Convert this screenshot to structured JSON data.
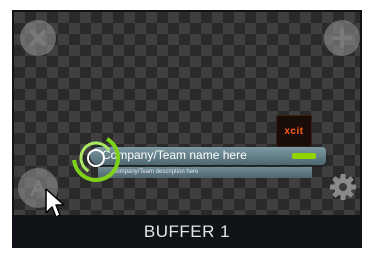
{
  "buffer": {
    "label": "BUFFER 1"
  },
  "lower_third": {
    "name": "Company/Team name here",
    "description": "Company/Team description here"
  },
  "logo": {
    "text": "xcit"
  },
  "icons": {
    "close": "close-icon",
    "add": "plus-icon",
    "settings": "gear-icon",
    "auto": "a-icon",
    "cursor": "mouse-pointer-icon"
  },
  "colors": {
    "accent_green": "#8fd400",
    "swirl_green": "#7ed21a",
    "logo_orange": "#ff5a1f"
  }
}
